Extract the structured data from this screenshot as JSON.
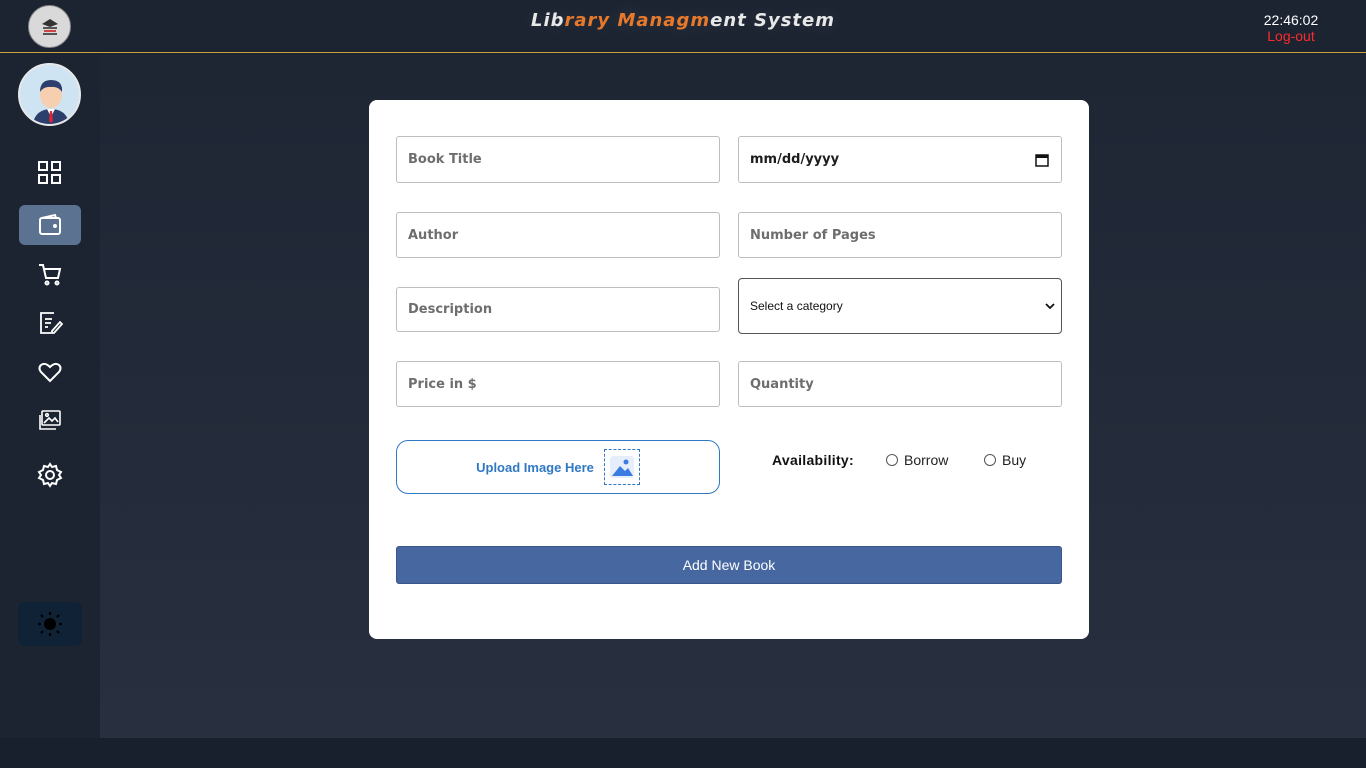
{
  "header": {
    "title_parts": [
      "Lib",
      "rary",
      " ",
      "Managm",
      "ent",
      " System"
    ],
    "clock": "22:46:02",
    "logout_label": "Log-out",
    "logo_caption": "LIBRARY"
  },
  "sidebar": {
    "items": [
      {
        "name": "dashboard",
        "icon": "grid-icon",
        "active": false
      },
      {
        "name": "wallet",
        "icon": "wallet-icon",
        "active": true
      },
      {
        "name": "cart",
        "icon": "cart-icon",
        "active": false
      },
      {
        "name": "edit",
        "icon": "edit-document-icon",
        "active": false
      },
      {
        "name": "favorites",
        "icon": "heart-icon",
        "active": false
      },
      {
        "name": "gallery",
        "icon": "images-icon",
        "active": false
      },
      {
        "name": "settings",
        "icon": "gear-icon",
        "active": false
      }
    ],
    "theme_toggle_icon": "sun-icon"
  },
  "form": {
    "book_title_placeholder": "Book Title",
    "date_placeholder": "mm/dd/yyyy",
    "author_placeholder": "Author",
    "pages_placeholder": "Number of Pages",
    "description_placeholder": "Description",
    "category_selected": "Select a category",
    "price_placeholder": "Price in $",
    "quantity_placeholder": "Quantity",
    "upload_label": "Upload Image Here",
    "availability_label": "Availability:",
    "availability_options": [
      "Borrow",
      "Buy"
    ],
    "submit_label": "Add New Book"
  },
  "colors": {
    "accent": "#e8792a",
    "logout": "#ff2a2a",
    "primary_button": "#4667a0",
    "upload_blue": "#2f78c4",
    "active_nav": "#5b7290"
  }
}
